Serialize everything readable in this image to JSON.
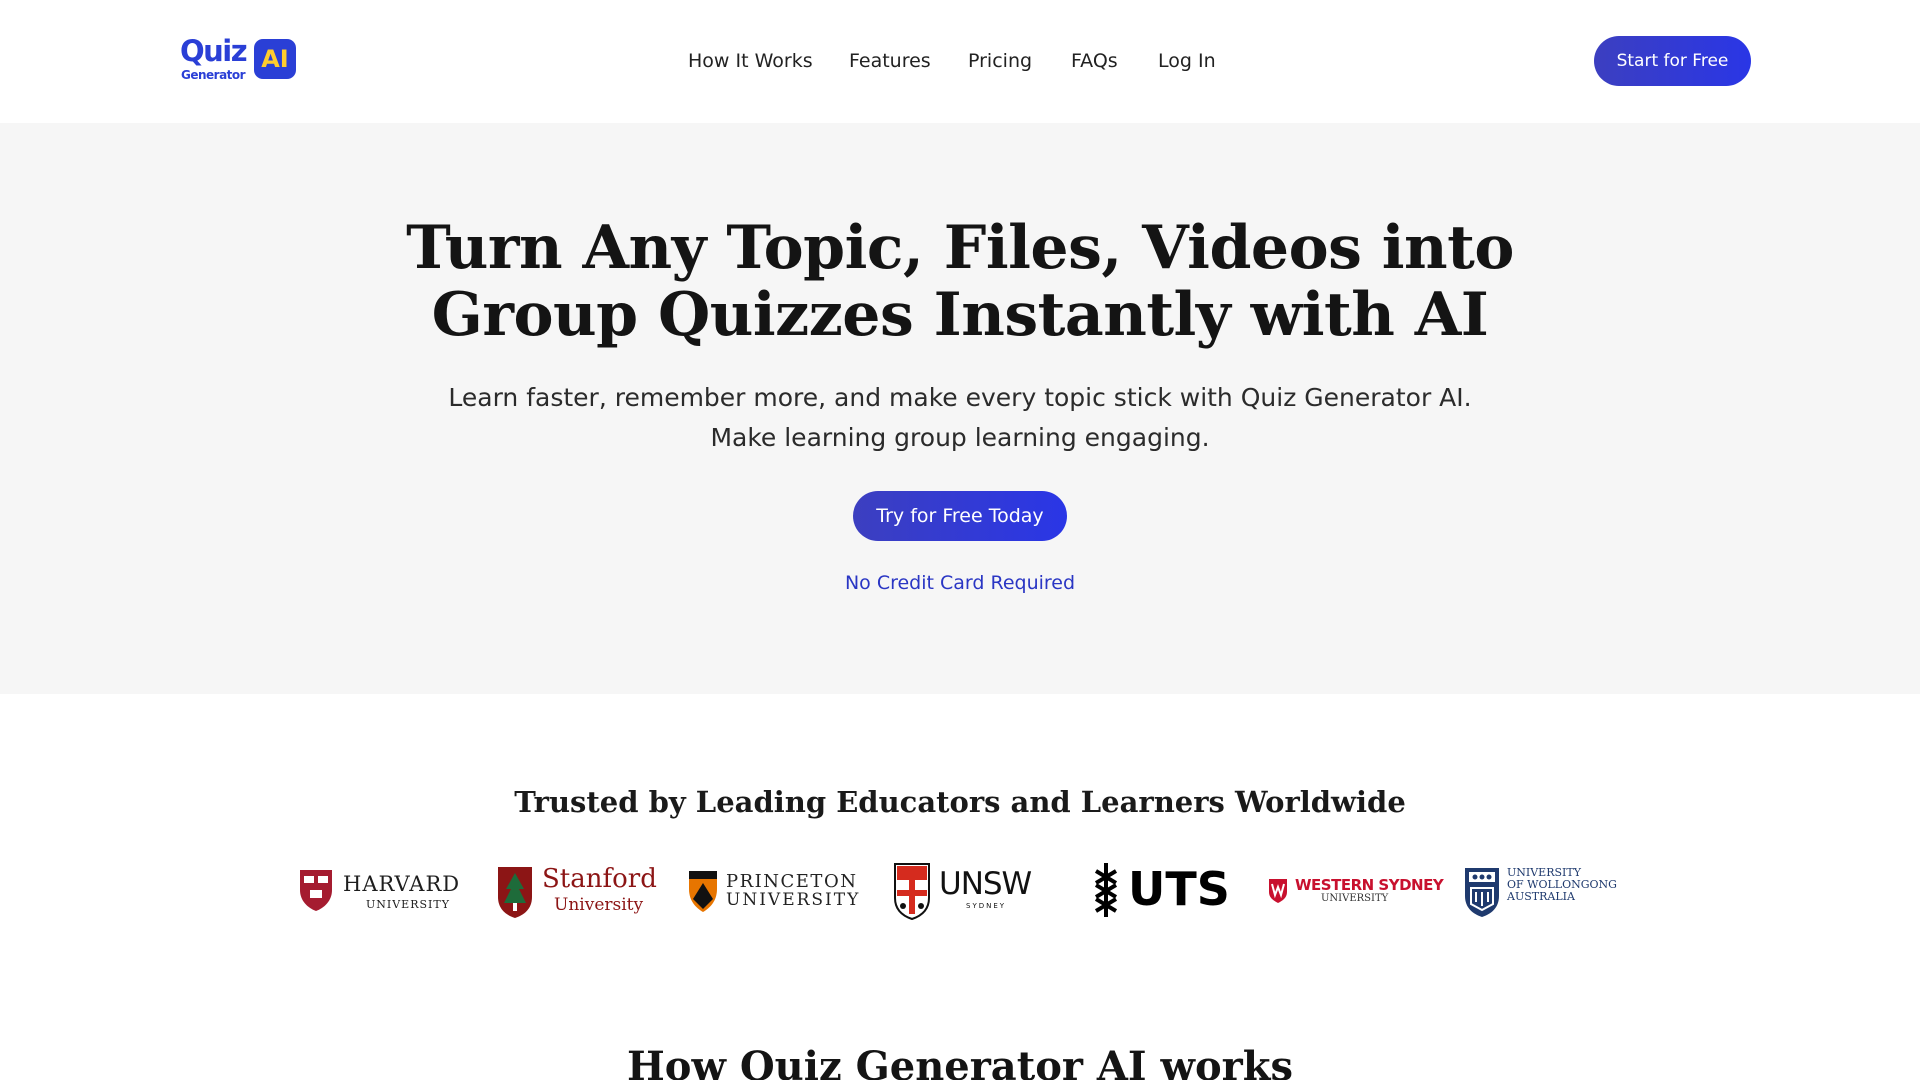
{
  "brand": {
    "logo_word": "Quiz",
    "logo_sub": "Generator",
    "logo_badge": "AI",
    "primary_color": "#2a36e6",
    "badge_text_color": "#ffcc2e"
  },
  "nav": {
    "items": [
      "How It Works",
      "Features",
      "Pricing",
      "FAQs",
      "Log In"
    ]
  },
  "header": {
    "cta_label": "Start for Free"
  },
  "hero": {
    "title_line1": "Turn Any Topic, Files, Videos into",
    "title_line2": "Group Quizzes Instantly with AI",
    "subtitle_line1": "Learn faster, remember more, and make every topic stick with Quiz Generator AI.",
    "subtitle_line2": "Make learning group learning engaging.",
    "cta_label": "Try for Free Today",
    "note": "No Credit Card Required",
    "background": "#f6f6f6"
  },
  "trusted": {
    "title": "Trusted by Leading Educators and Learners Worldwide",
    "logos": [
      {
        "name": "HARVARD",
        "sub": "UNIVERSITY",
        "color": "#a51c30"
      },
      {
        "name": "Stanford",
        "sub": "University",
        "color": "#8c1515"
      },
      {
        "name": "PRINCETON",
        "sub": "UNIVERSITY",
        "color": "#e77500"
      },
      {
        "name": "UNSW",
        "sub": "SYDNEY",
        "color": "#d52b1e"
      },
      {
        "name": "UTS",
        "sub": "",
        "color": "#000000"
      },
      {
        "name": "WESTERN SYDNEY",
        "sub": "UNIVERSITY",
        "color": "#c8102e"
      },
      {
        "name": "UNIVERSITY",
        "sub": "OF WOLLONGONG",
        "sub2": "AUSTRALIA",
        "color": "#1f3a6e"
      }
    ]
  },
  "next_section": {
    "title": "How Quiz Generator AI works"
  }
}
